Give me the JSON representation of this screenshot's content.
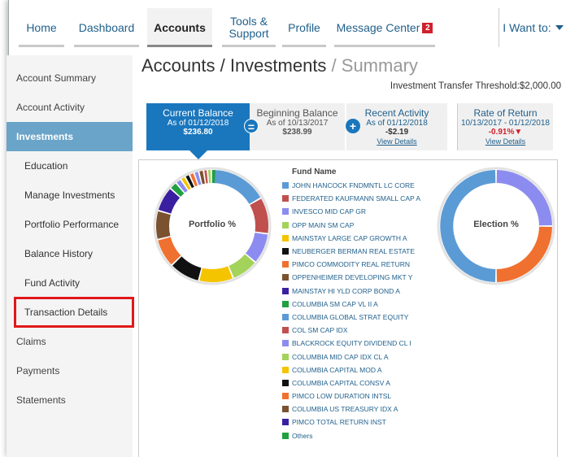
{
  "nav": {
    "items": [
      {
        "label": "Home",
        "line2": ""
      },
      {
        "label": "Dashboard",
        "line2": ""
      },
      {
        "label": "Accounts",
        "line2": ""
      },
      {
        "label": "Tools &",
        "line2": "Support"
      },
      {
        "label": "Profile",
        "line2": ""
      },
      {
        "label": "Message Center",
        "line2": ""
      }
    ],
    "message_count": "2",
    "i_want_label": "I Want to:"
  },
  "sidebar": {
    "items": [
      {
        "label": "Account Summary"
      },
      {
        "label": "Account Activity"
      },
      {
        "label": "Investments"
      },
      {
        "label": "Education"
      },
      {
        "label": "Manage Investments"
      },
      {
        "label": "Portfolio Performance"
      },
      {
        "label": "Balance History"
      },
      {
        "label": "Fund Activity"
      },
      {
        "label": "Transaction Details"
      },
      {
        "label": "Claims"
      },
      {
        "label": "Payments"
      },
      {
        "label": "Statements"
      }
    ]
  },
  "page": {
    "title_main": "Accounts / Investments",
    "title_sub": " / Summary",
    "threshold": "Investment Transfer Threshold:$2,000.00"
  },
  "tiles": {
    "current": {
      "label": "Current Balance",
      "sub": "As of 01/12/2018",
      "value": "$236.80"
    },
    "beginning": {
      "label": "Beginning Balance",
      "sub": "As of 10/13/2017",
      "value": "$238.99"
    },
    "recent": {
      "label": "Recent Activity",
      "sub": "As of 01/12/2018",
      "value": "-$2.19",
      "link": "View Details"
    },
    "rate": {
      "label": "Rate of Return",
      "sub": "10/13/2017 - 01/12/2018",
      "value": "-0.91%",
      "arrow": "▼",
      "link": "View Details"
    },
    "eq_symbol": "=",
    "plus_symbol": "+"
  },
  "charts": {
    "portfolio_label": "Portfolio %",
    "election_label": "Election %"
  },
  "legend": {
    "heading": "Fund Name",
    "items": [
      {
        "name": "JOHN HANCOCK FNDMNTL LC CORE",
        "color": "#5b9bd5"
      },
      {
        "name": "FEDERATED KAUFMANN SMALL CAP A",
        "color": "#c0504d"
      },
      {
        "name": "INVESCO MID CAP GR",
        "color": "#8c8cf0"
      },
      {
        "name": "OPP MAIN SM CAP",
        "color": "#a3d35a"
      },
      {
        "name": "MAINSTAY LARGE CAP GROWTH A",
        "color": "#f5c400"
      },
      {
        "name": "NEUBERGER BERMAN REAL ESTATE",
        "color": "#111111"
      },
      {
        "name": "PIMCO COMMODITY REAL RETURN",
        "color": "#f07030"
      },
      {
        "name": "OPPENHEIMER DEVELOPING MKT Y",
        "color": "#7a5230"
      },
      {
        "name": "MAINSTAY HI YLD CORP BOND A",
        "color": "#3a1fa0"
      },
      {
        "name": "COLUMBIA SM CAP VL II A",
        "color": "#20a040"
      },
      {
        "name": "COLUMBIA GLOBAL STRAT EQUITY",
        "color": "#5b9bd5"
      },
      {
        "name": "COL SM CAP IDX",
        "color": "#c0504d"
      },
      {
        "name": "BLACKROCK EQUITY DIVIDEND CL I",
        "color": "#8c8cf0"
      },
      {
        "name": "COLUMBIA MID CAP IDX CL A",
        "color": "#a3d35a"
      },
      {
        "name": "COLUMBIA CAPITAL MOD A",
        "color": "#f5c400"
      },
      {
        "name": "COLUMBIA CAPITAL CONSV A",
        "color": "#111111"
      },
      {
        "name": "PIMCO LOW DURATION INTSL",
        "color": "#f07030"
      },
      {
        "name": "COLUMBIA US TREASURY IDX A",
        "color": "#7a5230"
      },
      {
        "name": "PIMCO TOTAL RETURN INST",
        "color": "#3a1fa0"
      },
      {
        "name": "Others",
        "color": "#20a040"
      }
    ]
  }
}
